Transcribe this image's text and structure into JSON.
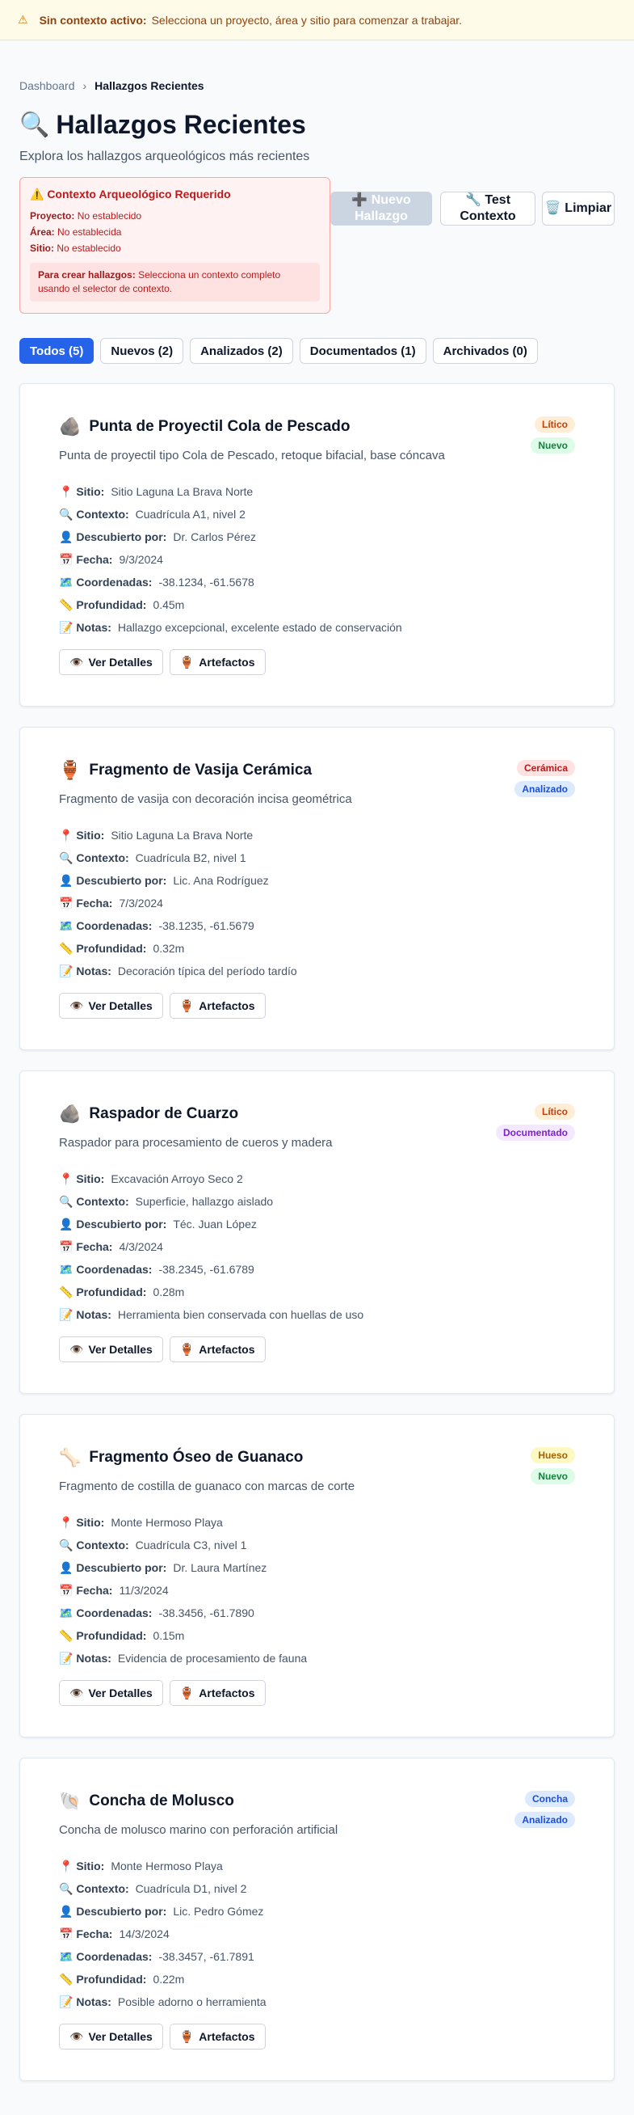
{
  "banner": {
    "label": "Sin contexto activo:",
    "text": "Selecciona un proyecto, área y sitio para comenzar a trabajar."
  },
  "breadcrumb": {
    "root": "Dashboard",
    "current": "Hallazgos Recientes"
  },
  "header": {
    "title": "Hallazgos Recientes",
    "subtitle": "Explora los hallazgos arqueológicos más recientes"
  },
  "context_box": {
    "title": "⚠️ Contexto Arqueológico Requerido",
    "project_label": "Proyecto:",
    "project_value": "No establecido",
    "area_label": "Área:",
    "area_value": "No establecida",
    "site_label": "Sitio:",
    "site_value": "No establecido",
    "note_label": "Para crear hallazgos:",
    "note_text": "Selecciona un contexto completo usando el selector de contexto."
  },
  "actions": {
    "new_label": "➕ Nuevo Hallazgo",
    "test_label": "🔧 Test Contexto",
    "clean_label": "🗑️ Limpiar"
  },
  "tabs": [
    {
      "label": "Todos (5)"
    },
    {
      "label": "Nuevos (2)"
    },
    {
      "label": "Analizados (2)"
    },
    {
      "label": "Documentados (1)"
    },
    {
      "label": "Archivados (0)"
    }
  ],
  "labels": {
    "site": "Sitio:",
    "context": "Contexto:",
    "discovered_by": "Descubierto por:",
    "date": "Fecha:",
    "coordinates": "Coordenadas:",
    "depth": "Profundidad:",
    "notes": "Notas:",
    "view_details": "Ver Detalles",
    "artifacts": "Artefactos"
  },
  "findings": [
    {
      "icon": "🪨",
      "title": "Punta de Proyectil Cola de Pescado",
      "description": "Punta de proyectil tipo Cola de Pescado, retoque bifacial, base cóncava",
      "type": "Lítico",
      "status": "Nuevo",
      "site": "Sitio Laguna La Brava Norte",
      "context": "Cuadrícula A1, nivel 2",
      "discovered_by": "Dr. Carlos Pérez",
      "date": "9/3/2024",
      "coordinates": "-38.1234, -61.5678",
      "depth": "0.45m",
      "notes": "Hallazgo excepcional, excelente estado de conservación"
    },
    {
      "icon": "🏺",
      "title": "Fragmento de Vasija Cerámica",
      "description": "Fragmento de vasija con decoración incisa geométrica",
      "type": "Cerámica",
      "status": "Analizado",
      "site": "Sitio Laguna La Brava Norte",
      "context": "Cuadrícula B2, nivel 1",
      "discovered_by": "Lic. Ana Rodríguez",
      "date": "7/3/2024",
      "coordinates": "-38.1235, -61.5679",
      "depth": "0.32m",
      "notes": "Decoración típica del período tardío"
    },
    {
      "icon": "🪨",
      "title": "Raspador de Cuarzo",
      "description": "Raspador para procesamiento de cueros y madera",
      "type": "Lítico",
      "status": "Documentado",
      "site": "Excavación Arroyo Seco 2",
      "context": "Superficie, hallazgo aislado",
      "discovered_by": "Téc. Juan López",
      "date": "4/3/2024",
      "coordinates": "-38.2345, -61.6789",
      "depth": "0.28m",
      "notes": "Herramienta bien conservada con huellas de uso"
    },
    {
      "icon": "🦴",
      "title": "Fragmento Óseo de Guanaco",
      "description": "Fragmento de costilla de guanaco con marcas de corte",
      "type": "Hueso",
      "status": "Nuevo",
      "site": "Monte Hermoso Playa",
      "context": "Cuadrícula C3, nivel 1",
      "discovered_by": "Dr. Laura Martínez",
      "date": "11/3/2024",
      "coordinates": "-38.3456, -61.7890",
      "depth": "0.15m",
      "notes": "Evidencia de procesamiento de fauna"
    },
    {
      "icon": "🐚",
      "title": "Concha de Molusco",
      "description": "Concha de molusco marino con perforación artificial",
      "type": "Concha",
      "status": "Analizado",
      "site": "Monte Hermoso Playa",
      "context": "Cuadrícula D1, nivel 2",
      "discovered_by": "Lic. Pedro Gómez",
      "date": "14/3/2024",
      "coordinates": "-38.3457, -61.7891",
      "depth": "0.22m",
      "notes": "Posible adorno o herramienta"
    }
  ],
  "colors": {
    "primary": "#2563eb",
    "type": {
      "Lítico": {
        "bg": "#ffedd5",
        "fg": "#c2410c"
      },
      "Cerámica": {
        "bg": "#fee2e2",
        "fg": "#b91c1c"
      },
      "Hueso": {
        "bg": "#fef9c3",
        "fg": "#a16207"
      },
      "Concha": {
        "bg": "#dbeafe",
        "fg": "#1d4ed8"
      }
    },
    "status": {
      "Nuevo": {
        "bg": "#dcfce7",
        "fg": "#15803d"
      },
      "Analizado": {
        "bg": "#dbeafe",
        "fg": "#1d4ed8"
      },
      "Documentado": {
        "bg": "#f3e8ff",
        "fg": "#7e22ce"
      }
    }
  }
}
